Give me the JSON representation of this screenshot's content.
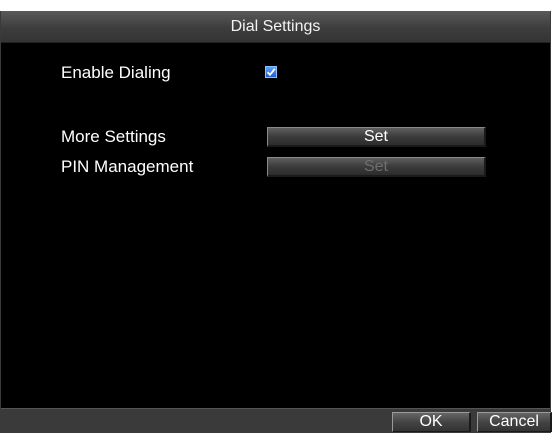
{
  "window": {
    "title": "Dial Settings"
  },
  "form": {
    "enable_dialing_label": "Enable Dialing",
    "enable_dialing_checked": true,
    "more_settings_label": "More Settings",
    "more_settings_button": "Set",
    "pin_management_label": "PIN Management",
    "pin_management_button": "Set",
    "pin_management_enabled": false
  },
  "footer": {
    "ok_label": "OK",
    "cancel_label": "Cancel"
  },
  "colors": {
    "background": "#000000",
    "checkbox_accent": "#2f7ae5",
    "disabled_text": "#6e6e6e"
  }
}
